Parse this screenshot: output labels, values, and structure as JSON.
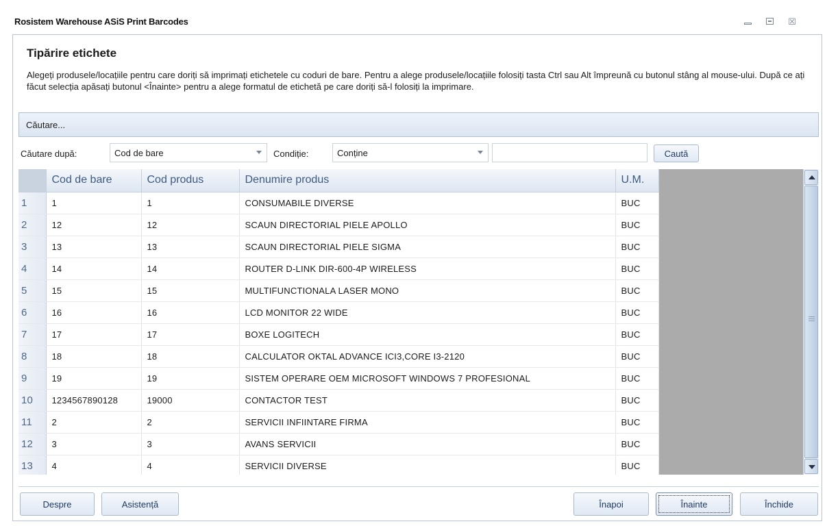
{
  "window": {
    "title": "Rosistem Warehouse ASiS Print Barcodes",
    "min_icon": "minimize-icon",
    "max_icon": "maximize-icon",
    "close_icon": "close-icon",
    "close_glyph": "☒"
  },
  "page": {
    "heading": "Tipărire etichete",
    "description": "Alegeți produsele/locațiile pentru care doriți să imprimați etichetele cu coduri de bare. Pentru a alege produsele/locațiile folosiți tasta Ctrl sau Alt împreună cu butonul stâng al mouse-ului. După ce ați făcut selecția apăsați butonul <Înainte> pentru a alege formatul de etichetă pe care doriți să-l folosiți la imprimare."
  },
  "search": {
    "bar_label": "Căutare...",
    "by_label": "Căutare după:",
    "by_value": "Cod de bare",
    "condition_label": "Condiție:",
    "condition_value": "Conține",
    "text_value": "",
    "button_label": "Caută"
  },
  "table": {
    "columns": [
      "",
      "Cod de bare",
      "Cod produs",
      "Denumire produs",
      "U.M."
    ],
    "rows": [
      [
        "1",
        "1",
        "1",
        "CONSUMABILE DIVERSE",
        "BUC"
      ],
      [
        "2",
        "12",
        "12",
        "SCAUN DIRECTORIAL PIELE APOLLO",
        "BUC"
      ],
      [
        "3",
        "13",
        "13",
        "SCAUN DIRECTORIAL PIELE SIGMA",
        "BUC"
      ],
      [
        "4",
        "14",
        "14",
        "ROUTER D-LINK DIR-600-4P WIRELESS",
        "BUC"
      ],
      [
        "5",
        "15",
        "15",
        "MULTIFUNCTIONALA LASER MONO",
        "BUC"
      ],
      [
        "6",
        "16",
        "16",
        "LCD MONITOR 22 WIDE",
        "BUC"
      ],
      [
        "7",
        "17",
        "17",
        "BOXE LOGITECH",
        "BUC"
      ],
      [
        "8",
        "18",
        "18",
        "CALCULATOR  OKTAL ADVANCE ICI3,CORE I3-2120",
        "BUC"
      ],
      [
        "9",
        "19",
        "19",
        "SISTEM  OPERARE  OEM  MICROSOFT  WINDOWS  7  PROFESIONAL",
        "BUC"
      ],
      [
        "10",
        "1234567890128",
        "19000",
        "CONTACTOR TEST",
        "BUC"
      ],
      [
        "11",
        "2",
        "2",
        "SERVICII INFIINTARE FIRMA",
        "BUC"
      ],
      [
        "12",
        "3",
        "3",
        "AVANS SERVICII",
        "BUC"
      ],
      [
        "13",
        "4",
        "4",
        "SERVICII DIVERSE",
        "BUC"
      ]
    ]
  },
  "footer": {
    "about": "Despre",
    "help": "Asistență",
    "back": "Înapoi",
    "next": "Înainte",
    "close": "Închide"
  },
  "colors": {
    "header_text": "#3c5a82",
    "accent": "#a7b8cf",
    "grid_empty": "#ababab"
  }
}
